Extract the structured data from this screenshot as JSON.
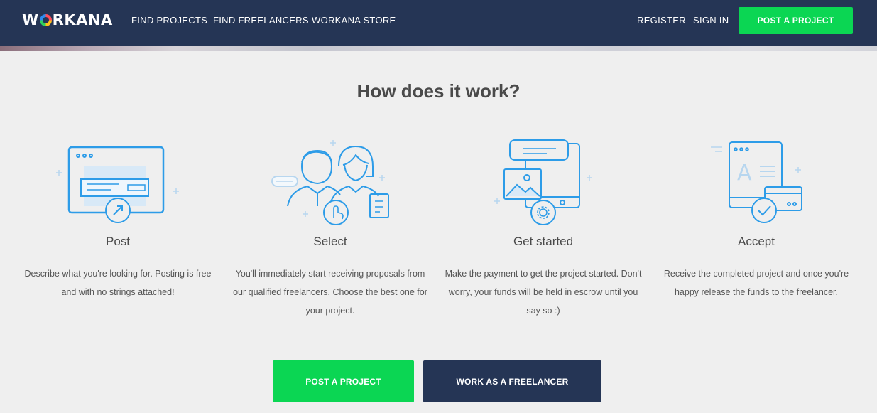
{
  "header": {
    "logo_text": "WORKANA",
    "nav": [
      "FIND PROJECTS",
      "FIND FREELANCERS",
      "WORKANA STORE"
    ],
    "register": "REGISTER",
    "sign_in": "SIGN IN",
    "post_project": "POST A PROJECT"
  },
  "section": {
    "title": "How does it work?"
  },
  "steps": [
    {
      "title": "Post",
      "description": "Describe what you're looking for. Posting is free and with no strings attached!",
      "icon": "browser-window-icon"
    },
    {
      "title": "Select",
      "description": "You'll immediately start receiving proposals from our qualified freelancers. Choose the best one for your project.",
      "icon": "people-select-icon"
    },
    {
      "title": "Get started",
      "description": "Make the payment to get the project started. Don't worry, your funds will be held in escrow until you say so :)",
      "icon": "devices-gear-icon"
    },
    {
      "title": "Accept",
      "description": "Receive the completed project and once you're happy release the funds to the freelancer.",
      "icon": "tablet-card-check-icon"
    }
  ],
  "cta": {
    "post_project": "POST A PROJECT",
    "work_freelancer": "WORK AS A FREELANCER"
  },
  "colors": {
    "navy": "#253555",
    "green": "#0bd653",
    "icon_blue": "#2d9ce8",
    "background": "#efefef"
  }
}
